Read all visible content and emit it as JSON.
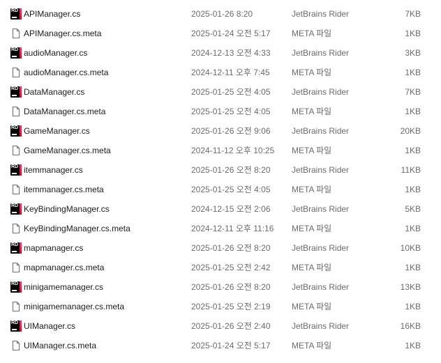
{
  "files": [
    {
      "name": "APIManager.cs",
      "modified": "2025-01-26 8:20",
      "type": "JetBrains Rider",
      "size": "7KB",
      "icon": "rider-icon",
      "icon_text": "RD"
    },
    {
      "name": "APIManager.cs.meta",
      "modified": "2025-01-24 오전 5:17",
      "type": "META 파일",
      "size": "1KB",
      "icon": "file-icon"
    },
    {
      "name": "audioManager.cs",
      "modified": "2024-12-13 오전 4:33",
      "type": "JetBrains Rider",
      "size": "3KB",
      "icon": "rider-icon",
      "icon_text": "RD"
    },
    {
      "name": "audioManager.cs.meta",
      "modified": "2024-12-11 오후 7:45",
      "type": "META 파일",
      "size": "1KB",
      "icon": "file-icon"
    },
    {
      "name": "DataManager.cs",
      "modified": "2025-01-25 오전 4:05",
      "type": "JetBrains Rider",
      "size": "7KB",
      "icon": "rider-icon",
      "icon_text": "RD"
    },
    {
      "name": "DataManager.cs.meta",
      "modified": "2025-01-25 오전 4:05",
      "type": "META 파일",
      "size": "1KB",
      "icon": "file-icon"
    },
    {
      "name": "GameManager.cs",
      "modified": "2025-01-26 오전 9:06",
      "type": "JetBrains Rider",
      "size": "20KB",
      "icon": "rider-icon",
      "icon_text": "RD"
    },
    {
      "name": "GameManager.cs.meta",
      "modified": "2024-11-12 오후 10:25",
      "type": "META 파일",
      "size": "1KB",
      "icon": "file-icon"
    },
    {
      "name": "itemmanager.cs",
      "modified": "2025-01-26 오전 8:20",
      "type": "JetBrains Rider",
      "size": "11KB",
      "icon": "rider-icon",
      "icon_text": "RD"
    },
    {
      "name": "itemmanager.cs.meta",
      "modified": "2025-01-25 오전 4:05",
      "type": "META 파일",
      "size": "1KB",
      "icon": "file-icon"
    },
    {
      "name": "KeyBindingManager.cs",
      "modified": "2024-12-15 오전 2:06",
      "type": "JetBrains Rider",
      "size": "5KB",
      "icon": "rider-icon",
      "icon_text": "RD"
    },
    {
      "name": "KeyBindingManager.cs.meta",
      "modified": "2024-12-11 오후 11:16",
      "type": "META 파일",
      "size": "1KB",
      "icon": "file-icon"
    },
    {
      "name": "mapmanager.cs",
      "modified": "2025-01-26 오전 8:20",
      "type": "JetBrains Rider",
      "size": "10KB",
      "icon": "rider-icon",
      "icon_text": "RD"
    },
    {
      "name": "mapmanager.cs.meta",
      "modified": "2025-01-25 오전 2:42",
      "type": "META 파일",
      "size": "1KB",
      "icon": "file-icon"
    },
    {
      "name": "minigamemanager.cs",
      "modified": "2025-01-26 오전 8:20",
      "type": "JetBrains Rider",
      "size": "13KB",
      "icon": "rider-icon",
      "icon_text": "RD"
    },
    {
      "name": "minigamemanager.cs.meta",
      "modified": "2025-01-25 오전 2:19",
      "type": "META 파일",
      "size": "1KB",
      "icon": "file-icon"
    },
    {
      "name": "UIManager.cs",
      "modified": "2025-01-26 오전 2:40",
      "type": "JetBrains Rider",
      "size": "16KB",
      "icon": "rider-icon",
      "icon_text": "RD"
    },
    {
      "name": "UIManager.cs.meta",
      "modified": "2025-01-24 오전 5:17",
      "type": "META 파일",
      "size": "1KB",
      "icon": "file-icon"
    }
  ],
  "colors": {
    "rider_icon_bg": "#000000",
    "rider_icon_accent": "#e83c6b",
    "row_hover": "#e5f3ff"
  }
}
